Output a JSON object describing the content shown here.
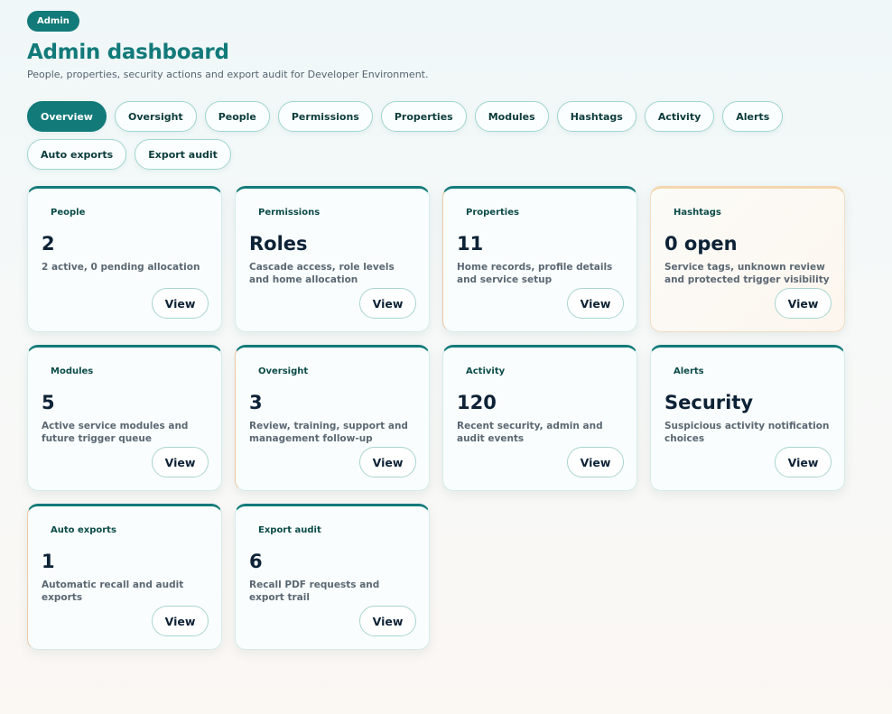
{
  "header": {
    "badge": "Admin",
    "title": "Admin dashboard",
    "subtitle": "People, properties, security actions and export audit for Developer Environment."
  },
  "tabs": [
    {
      "label": "Overview",
      "active": true
    },
    {
      "label": "Oversight"
    },
    {
      "label": "People"
    },
    {
      "label": "Permissions"
    },
    {
      "label": "Properties"
    },
    {
      "label": "Modules"
    },
    {
      "label": "Hashtags"
    },
    {
      "label": "Activity"
    },
    {
      "label": "Alerts"
    },
    {
      "label": "Auto exports"
    },
    {
      "label": "Export audit"
    }
  ],
  "cards": [
    {
      "label": "People",
      "value": "2",
      "desc": "2 active, 0 pending allocation",
      "button": "View"
    },
    {
      "label": "Permissions",
      "value": "Roles",
      "desc": "Cascade access, role levels and home allocation",
      "button": "View"
    },
    {
      "label": "Properties",
      "value": "11",
      "desc": "Home records, profile details and service setup",
      "button": "View"
    },
    {
      "label": "Hashtags",
      "value": "0 open",
      "desc": "Service tags, unknown review and protected trigger visibility",
      "button": "View"
    },
    {
      "label": "Modules",
      "value": "5",
      "desc": "Active service modules and future trigger queue",
      "button": "View"
    },
    {
      "label": "Oversight",
      "value": "3",
      "desc": "Review, training, support and management follow-up",
      "button": "View"
    },
    {
      "label": "Activity",
      "value": "120",
      "desc": "Recent security, admin and audit events",
      "button": "View"
    },
    {
      "label": "Alerts",
      "value": "Security",
      "desc": "Suspicious activity notification choices",
      "button": "View"
    },
    {
      "label": "Auto exports",
      "value": "1",
      "desc": "Automatic recall and audit exports",
      "button": "View"
    },
    {
      "label": "Export audit",
      "value": "6",
      "desc": "Recall PDF requests and export trail",
      "button": "View"
    }
  ],
  "colors": {
    "accent": "#137a7a",
    "text_dark": "#0d2236",
    "text_muted": "#5b6873"
  }
}
